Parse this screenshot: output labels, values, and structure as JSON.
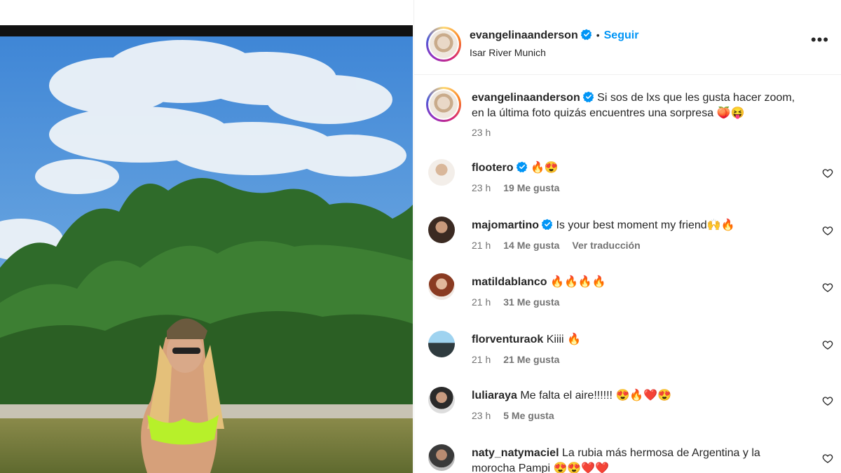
{
  "post": {
    "username": "evangelinaanderson",
    "separator": "•",
    "follow_label": "Seguir",
    "location": "Isar River Munich",
    "more_label": "•••"
  },
  "caption": {
    "username": "evangelinaanderson",
    "text_line1": "Si sos de lxs que les gusta hacer zoom,",
    "text_line2": "en la última foto quizás encuentres una sorpresa 🍑😝",
    "time": "23 h"
  },
  "comments": [
    {
      "username": "flootero",
      "verified": true,
      "text": "🔥😍",
      "time": "23 h",
      "likes": "19 Me gusta",
      "translate": ""
    },
    {
      "username": "majomartino",
      "verified": true,
      "text": "Is your best moment my friend🙌🔥",
      "time": "21 h",
      "likes": "14 Me gusta",
      "translate": "Ver traducción"
    },
    {
      "username": "matildablanco",
      "verified": false,
      "text": "🔥🔥🔥🔥",
      "time": "21 h",
      "likes": "31 Me gusta",
      "translate": ""
    },
    {
      "username": "florventuraok",
      "verified": false,
      "text": "Kiiii 🔥",
      "time": "21 h",
      "likes": "21 Me gusta",
      "translate": ""
    },
    {
      "username": "luliaraya",
      "verified": false,
      "text": "Me falta el aire!!!!!! 😍🔥❤️😍",
      "time": "23 h",
      "likes": "5 Me gusta",
      "translate": ""
    },
    {
      "username": "naty_natymaciel",
      "verified": false,
      "text": "La rubia más hermosa de Argentina y la",
      "text2": "morocha Pampi 😍😍❤️❤️",
      "time": "",
      "likes": "",
      "translate": ""
    }
  ],
  "icons": {
    "verified": "verified-badge-icon",
    "heart": "heart-outline-icon",
    "more": "more-options-icon"
  },
  "colors": {
    "follow": "#0095f6",
    "verified": "#0095f6",
    "meta": "#737373"
  }
}
